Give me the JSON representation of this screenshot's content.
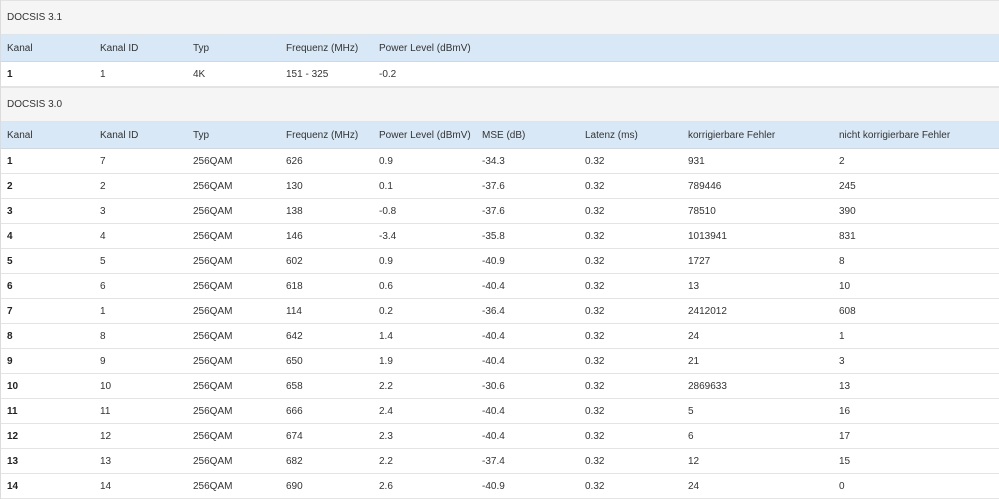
{
  "docsis31": {
    "title": "DOCSIS 3.1",
    "headers": [
      "Kanal",
      "Kanal ID",
      "Typ",
      "Frequenz (MHz)",
      "Power Level (dBmV)"
    ],
    "rows": [
      [
        "1",
        "1",
        "4K",
        "151 - 325",
        "-0.2"
      ]
    ]
  },
  "docsis30": {
    "title": "DOCSIS 3.0",
    "headers": [
      "Kanal",
      "Kanal ID",
      "Typ",
      "Frequenz (MHz)",
      "Power Level (dBmV)",
      "MSE (dB)",
      "Latenz (ms)",
      "korrigierbare Fehler",
      "nicht korrigierbare Fehler"
    ],
    "rows": [
      [
        "1",
        "7",
        "256QAM",
        "626",
        "0.9",
        "-34.3",
        "0.32",
        "931",
        "2"
      ],
      [
        "2",
        "2",
        "256QAM",
        "130",
        "0.1",
        "-37.6",
        "0.32",
        "789446",
        "245"
      ],
      [
        "3",
        "3",
        "256QAM",
        "138",
        "-0.8",
        "-37.6",
        "0.32",
        "78510",
        "390"
      ],
      [
        "4",
        "4",
        "256QAM",
        "146",
        "-3.4",
        "-35.8",
        "0.32",
        "1013941",
        "831"
      ],
      [
        "5",
        "5",
        "256QAM",
        "602",
        "0.9",
        "-40.9",
        "0.32",
        "1727",
        "8"
      ],
      [
        "6",
        "6",
        "256QAM",
        "618",
        "0.6",
        "-40.4",
        "0.32",
        "13",
        "10"
      ],
      [
        "7",
        "1",
        "256QAM",
        "114",
        "0.2",
        "-36.4",
        "0.32",
        "2412012",
        "608"
      ],
      [
        "8",
        "8",
        "256QAM",
        "642",
        "1.4",
        "-40.4",
        "0.32",
        "24",
        "1"
      ],
      [
        "9",
        "9",
        "256QAM",
        "650",
        "1.9",
        "-40.4",
        "0.32",
        "21",
        "3"
      ],
      [
        "10",
        "10",
        "256QAM",
        "658",
        "2.2",
        "-30.6",
        "0.32",
        "2869633",
        "13"
      ],
      [
        "11",
        "11",
        "256QAM",
        "666",
        "2.4",
        "-40.4",
        "0.32",
        "5",
        "16"
      ],
      [
        "12",
        "12",
        "256QAM",
        "674",
        "2.3",
        "-40.4",
        "0.32",
        "6",
        "17"
      ],
      [
        "13",
        "13",
        "256QAM",
        "682",
        "2.2",
        "-37.4",
        "0.32",
        "12",
        "15"
      ],
      [
        "14",
        "14",
        "256QAM",
        "690",
        "2.6",
        "-40.9",
        "0.32",
        "24",
        "0"
      ]
    ]
  }
}
